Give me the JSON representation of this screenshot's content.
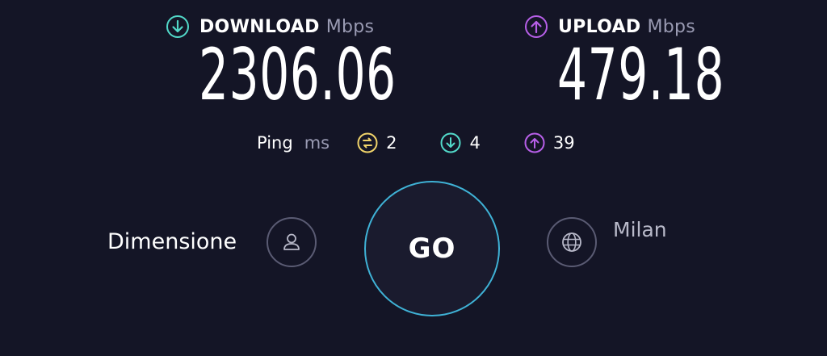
{
  "download": {
    "label": "DOWNLOAD",
    "unit": "Mbps",
    "value": "2306.06",
    "icon": "download-arrow-icon",
    "color": "#52d9c9"
  },
  "upload": {
    "label": "UPLOAD",
    "unit": "Mbps",
    "value": "479.18",
    "icon": "upload-arrow-icon",
    "color": "#b75fe8"
  },
  "ping": {
    "label": "Ping",
    "unit": "ms",
    "idle": {
      "value": "2",
      "icon": "idle-latency-icon",
      "color": "#f0d36a"
    },
    "download": {
      "value": "4",
      "icon": "download-latency-icon",
      "color": "#52d9c9"
    },
    "upload": {
      "value": "39",
      "icon": "upload-latency-icon",
      "color": "#b75fe8"
    }
  },
  "device": {
    "label": "Dimensione",
    "icon": "user-icon"
  },
  "go": {
    "label": "GO"
  },
  "server": {
    "label": "Milan",
    "icon": "globe-icon"
  }
}
